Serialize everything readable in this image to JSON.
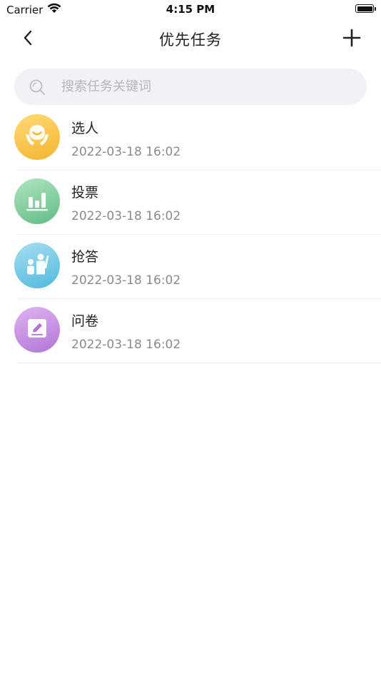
{
  "status_bar": {
    "carrier": "Carrier",
    "time": "4:15 PM",
    "wifi_icon": "wifi-icon",
    "battery_icon": "battery-icon"
  },
  "nav": {
    "title": "优先任务",
    "back_icon": "chevron-left-icon",
    "add_icon": "plus-icon"
  },
  "search": {
    "placeholder": "搜索任务关键词",
    "icon": "search-icon"
  },
  "tasks": [
    {
      "name": "选人",
      "date": "2022-03-18 16:02",
      "icon": "person-select-icon",
      "color_from": "#ffd466",
      "color_to": "#f7b731"
    },
    {
      "name": "投票",
      "date": "2022-03-18 16:02",
      "icon": "bar-chart-icon",
      "color_from": "#a8dfb8",
      "color_to": "#6cc28c"
    },
    {
      "name": "抢答",
      "date": "2022-03-18 16:02",
      "icon": "raise-hand-icon",
      "color_from": "#9fdcef",
      "color_to": "#5bbfe0"
    },
    {
      "name": "问卷",
      "date": "2022-03-18 16:02",
      "icon": "edit-form-icon",
      "color_from": "#dba8ef",
      "color_to": "#b57ad6"
    }
  ]
}
